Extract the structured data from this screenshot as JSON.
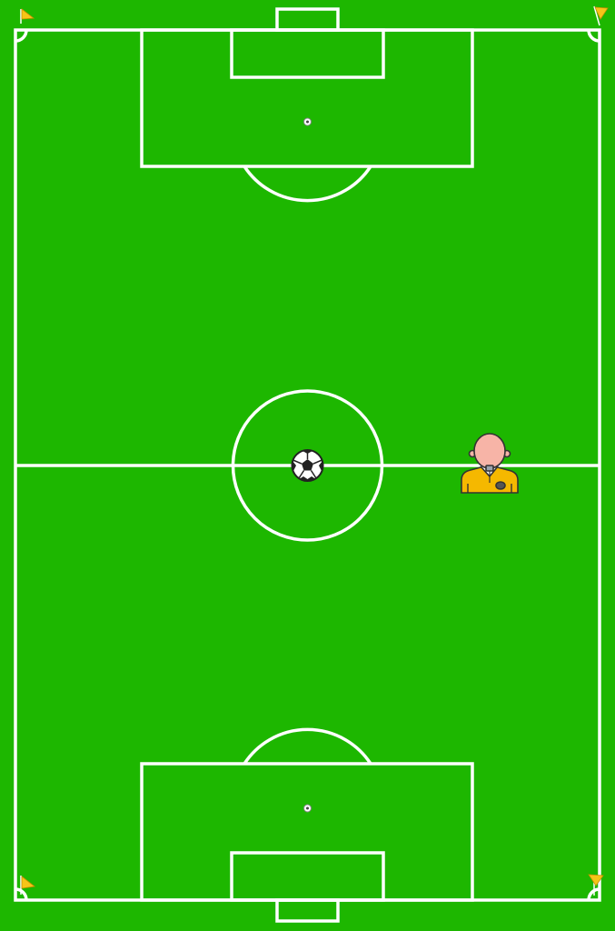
{
  "pitch": {
    "grass_color": "#1db700",
    "line_color": "#ffffff"
  },
  "corner_flags": {
    "flag_color": "#f5c518",
    "icon": "corner-flag-icon"
  },
  "ball": {
    "icon": "soccer-ball-icon",
    "location": "center-spot"
  },
  "referee": {
    "icon": "referee-icon",
    "shirt_color": "#f5b800",
    "skin_color": "#f7b4a7"
  }
}
